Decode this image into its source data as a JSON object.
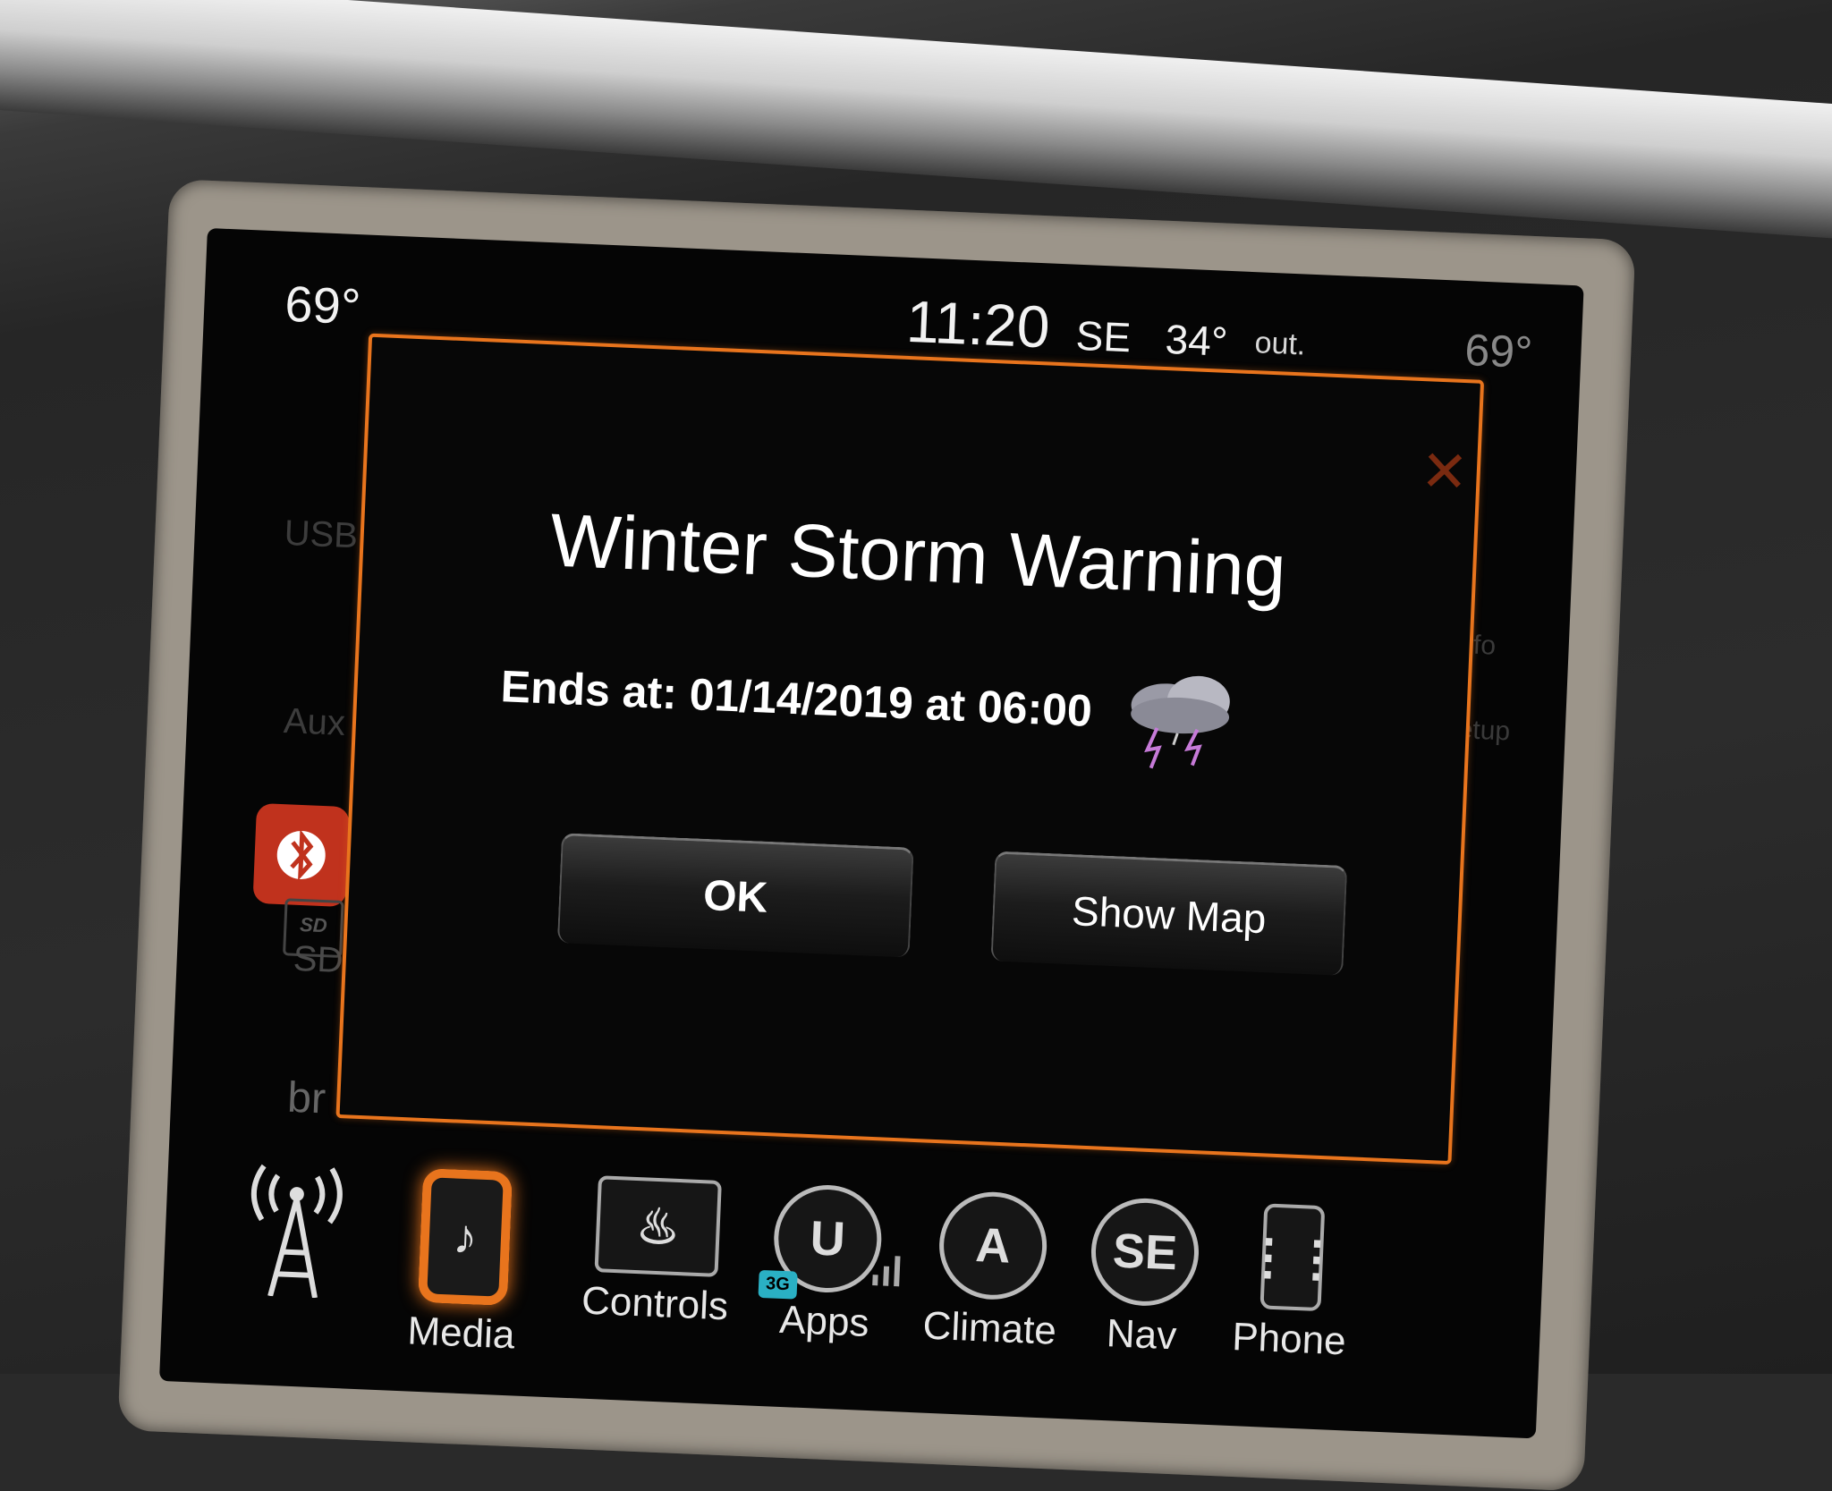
{
  "status_bar": {
    "temp_left": "69°",
    "clock": "11:20",
    "heading": "SE",
    "outside_temp": "34°",
    "outside_label": "out.",
    "temp_right": "69°"
  },
  "sidebar": {
    "usb": "USB",
    "aux": "Aux",
    "sd": "SD",
    "br": "br",
    "bt_color": "#c0321d"
  },
  "right_side": {
    "info": "info",
    "setup": "setup"
  },
  "popup": {
    "title": "Winter Storm Warning",
    "ends_label": "Ends at: 01/14/2019 at 06:00",
    "icon": "thunderstorm-icon",
    "ok_label": "OK",
    "show_map_label": "Show Map",
    "border_color": "#e8741d"
  },
  "navbar": {
    "items": [
      {
        "label": "",
        "icon": "radio-tower-icon"
      },
      {
        "label": "Media",
        "icon": "music-note-icon"
      },
      {
        "label": "Controls",
        "icon": "seat-icon"
      },
      {
        "label": "Apps",
        "icon": "uconnect-icon",
        "badge": "3G"
      },
      {
        "label": "Climate",
        "icon": "climate-icon",
        "glyph": "A"
      },
      {
        "label": "Nav",
        "icon": "compass-icon",
        "glyph": "SE"
      },
      {
        "label": "Phone",
        "icon": "phone-icon"
      }
    ],
    "accent": "#e8741d"
  }
}
